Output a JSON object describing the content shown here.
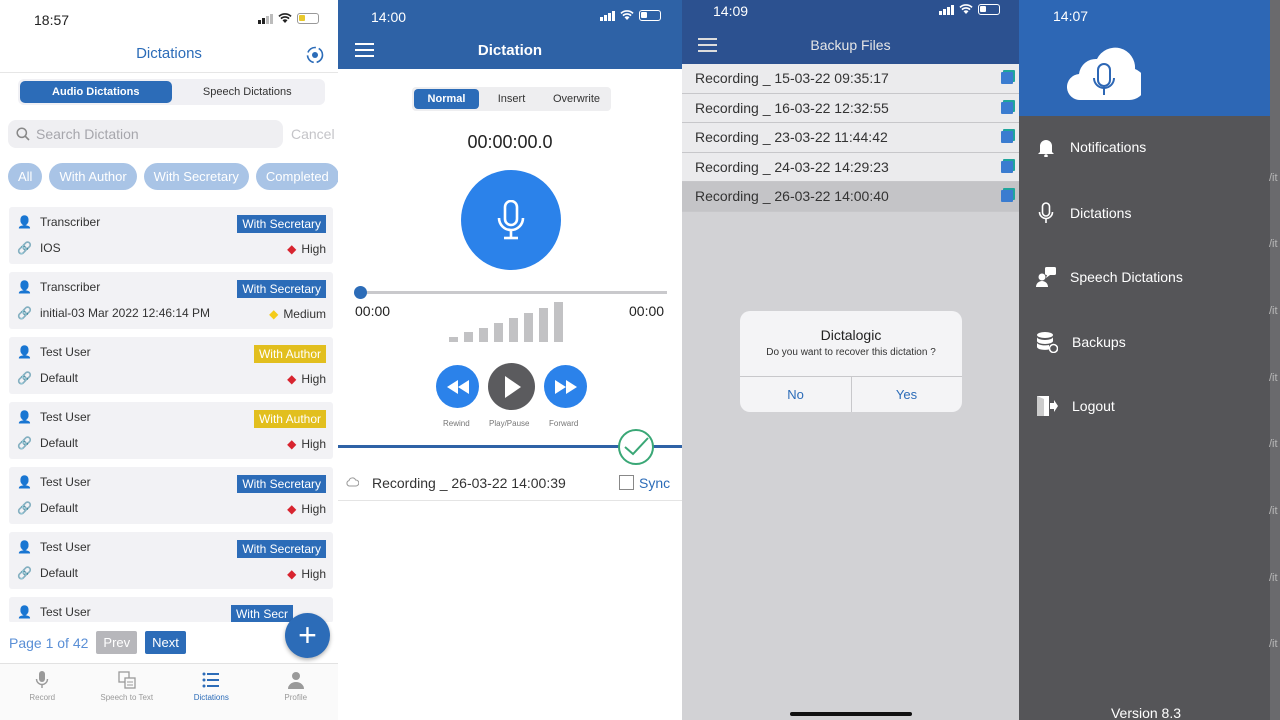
{
  "panel1": {
    "status_time": "18:57",
    "title": "Dictations",
    "segments": [
      "Audio Dictations",
      "Speech Dictations"
    ],
    "search_placeholder": "Search Dictation",
    "cancel": "Cancel",
    "filters": [
      "All",
      "With Author",
      "With Secretary",
      "Completed"
    ],
    "cards": [
      {
        "user": "Transcriber",
        "item": "IOS",
        "status": "With Secretary",
        "priority": "High"
      },
      {
        "user": "Transcriber",
        "item": "initial-03 Mar 2022 12:46:14 PM",
        "status": "With Secretary",
        "priority": "Medium"
      },
      {
        "user": "Test User",
        "item": "Default",
        "status": "With Author",
        "priority": "High"
      },
      {
        "user": "Test User",
        "item": "Default",
        "status": "With Author",
        "priority": "High"
      },
      {
        "user": "Test User",
        "item": "Default",
        "status": "With Secretary",
        "priority": "High"
      },
      {
        "user": "Test User",
        "item": "Default",
        "status": "With Secretary",
        "priority": "High"
      },
      {
        "user": "Test User",
        "status": "With Secr"
      }
    ],
    "page_label": "Page 1 of 42",
    "prev": "Prev",
    "next": "Next",
    "fab": "+",
    "tabs": [
      "Record",
      "Speech to Text",
      "Dictations",
      "Profile"
    ]
  },
  "panel2": {
    "status_time": "14:00",
    "title": "Dictation",
    "modes": [
      "Normal",
      "Insert",
      "Overwrite"
    ],
    "timer": "00:00:00.0",
    "elapsed": "00:00",
    "total": "00:00",
    "rewind": "Rewind",
    "playpause": "Play/Pause",
    "forward": "Forward",
    "recording_name": "Recording _ 26-03-22 14:00:39",
    "sync": "Sync"
  },
  "panel3": {
    "status_time": "14:09",
    "title": "Backup Files",
    "recordings": [
      "Recording _ 15-03-22 09:35:17",
      "Recording _ 16-03-22 12:32:55",
      "Recording _ 23-03-22 11:44:42",
      "Recording _ 24-03-22 14:29:23",
      "Recording _ 26-03-22 14:00:40"
    ],
    "dialog": {
      "title": "Dictalogic",
      "message": "Do you want to recover this dictation ?",
      "no": "No",
      "yes": "Yes"
    }
  },
  "panel4": {
    "status_time": "14:07",
    "menu": [
      "Notifications",
      "Dictations",
      "Speech Dictations",
      "Backups",
      "Logout"
    ],
    "version": "Version 8.3"
  },
  "colors": {
    "primary": "#2c6cb8",
    "header_blue": "#2e62a6",
    "with_author": "#e2bf1e",
    "high_priority": "#d8242f",
    "medium_priority": "#f4cc1a",
    "drawer_gray": "#555558"
  }
}
